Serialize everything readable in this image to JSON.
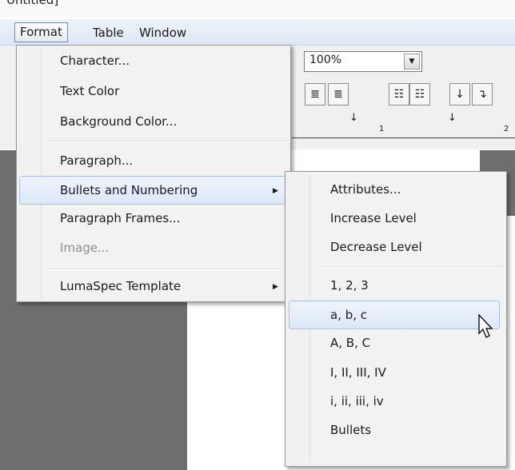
{
  "window": {
    "title": "Untitled]"
  },
  "menubar": {
    "items": [
      "Format",
      "Table",
      "Window"
    ]
  },
  "toolbar": {
    "zoom_value": "100%",
    "dropdown_arrow": "▼",
    "buttons": [
      "≣",
      "≣",
      "☷",
      "☷",
      "↓",
      "↴"
    ]
  },
  "ruler": {
    "marks": [
      "1",
      "2"
    ]
  },
  "format_menu": {
    "items": [
      {
        "label": "Character..."
      },
      {
        "label": "Text Color"
      },
      {
        "label": "Background Color..."
      },
      {
        "label": "Paragraph..."
      },
      {
        "label": "Bullets and Numbering",
        "submenu": true,
        "highlighted": true
      },
      {
        "label": "Paragraph Frames..."
      },
      {
        "label": "Image...",
        "disabled": true
      },
      {
        "label": "LumaSpec Template",
        "submenu": true
      }
    ]
  },
  "bullets_submenu": {
    "items": [
      {
        "label": "Attributes..."
      },
      {
        "label": "Increase Level"
      },
      {
        "label": "Decrease Level"
      },
      {
        "label": "1, 2, 3"
      },
      {
        "label": "a, b, c",
        "highlighted": true
      },
      {
        "label": "A, B, C"
      },
      {
        "label": "I, II, III, IV"
      },
      {
        "label": "i, ii, iii, iv"
      },
      {
        "label": "Bullets"
      }
    ]
  },
  "submenu_arrow": "▶",
  "colors": {
    "highlight": "#dce8f8",
    "menu_bg": "#f2f2f2",
    "canvas": "#6e6e6e"
  }
}
